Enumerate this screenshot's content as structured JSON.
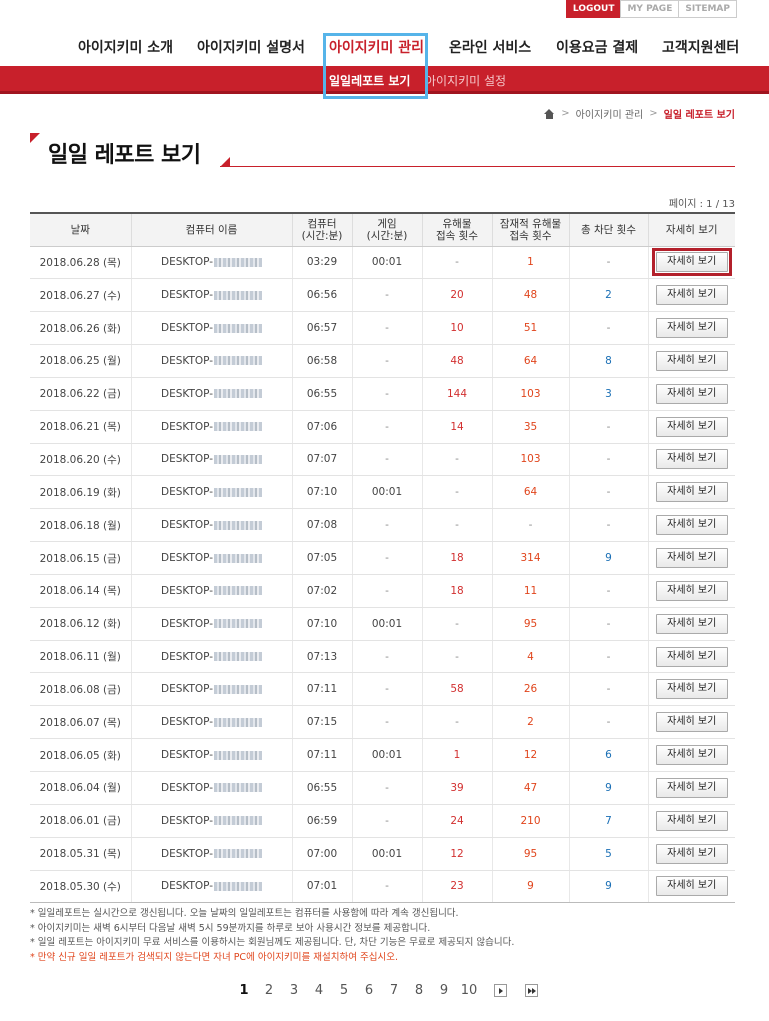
{
  "util": {
    "logout": "LOGOUT",
    "mypage": "MY PAGE",
    "sitemap": "SITEMAP"
  },
  "nav": {
    "items": [
      "아이지키미 소개",
      "아이지키미 설명서",
      "아이지키미 관리",
      "온라인 서비스",
      "이용요금 결제",
      "고객지원센터"
    ],
    "sub": [
      "일일레포트 보기",
      "아이지키미 설정"
    ]
  },
  "breadcrumb": {
    "level1": "아이지키미 관리",
    "current": "일일 레포트 보기"
  },
  "page_title": "일일 레포트 보기",
  "page_info": "페이지 : 1 / 13",
  "table": {
    "headers": [
      "날짜",
      "컴퓨터 이름",
      "컴퓨터\n(시간:분)",
      "게임\n(시간:분)",
      "유해물\n접속 횟수",
      "잠재적 유해물\n접속 횟수",
      "총 차단 횟수",
      "자세히 보기"
    ],
    "button_label": "자세히 보기",
    "rows": [
      {
        "date": "2018.06.28 (목)",
        "pc": "DESKTOP-",
        "pc_time": "03:29",
        "game": "00:01",
        "harm": "-",
        "potential": "1",
        "blocked": "-"
      },
      {
        "date": "2018.06.27 (수)",
        "pc": "DESKTOP-",
        "pc_time": "06:56",
        "game": "-",
        "harm": "20",
        "potential": "48",
        "blocked": "2"
      },
      {
        "date": "2018.06.26 (화)",
        "pc": "DESKTOP-",
        "pc_time": "06:57",
        "game": "-",
        "harm": "10",
        "potential": "51",
        "blocked": "-"
      },
      {
        "date": "2018.06.25 (월)",
        "pc": "DESKTOP-",
        "pc_time": "06:58",
        "game": "-",
        "harm": "48",
        "potential": "64",
        "blocked": "8"
      },
      {
        "date": "2018.06.22 (금)",
        "pc": "DESKTOP-",
        "pc_time": "06:55",
        "game": "-",
        "harm": "144",
        "potential": "103",
        "blocked": "3"
      },
      {
        "date": "2018.06.21 (목)",
        "pc": "DESKTOP-",
        "pc_time": "07:06",
        "game": "-",
        "harm": "14",
        "potential": "35",
        "blocked": "-"
      },
      {
        "date": "2018.06.20 (수)",
        "pc": "DESKTOP-",
        "pc_time": "07:07",
        "game": "-",
        "harm": "-",
        "potential": "103",
        "blocked": "-"
      },
      {
        "date": "2018.06.19 (화)",
        "pc": "DESKTOP-",
        "pc_time": "07:10",
        "game": "00:01",
        "harm": "-",
        "potential": "64",
        "blocked": "-"
      },
      {
        "date": "2018.06.18 (월)",
        "pc": "DESKTOP-",
        "pc_time": "07:08",
        "game": "-",
        "harm": "-",
        "potential": "-",
        "blocked": "-"
      },
      {
        "date": "2018.06.15 (금)",
        "pc": "DESKTOP-",
        "pc_time": "07:05",
        "game": "-",
        "harm": "18",
        "potential": "314",
        "blocked": "9"
      },
      {
        "date": "2018.06.14 (목)",
        "pc": "DESKTOP-",
        "pc_time": "07:02",
        "game": "-",
        "harm": "18",
        "potential": "11",
        "blocked": "-"
      },
      {
        "date": "2018.06.12 (화)",
        "pc": "DESKTOP-",
        "pc_time": "07:10",
        "game": "00:01",
        "harm": "-",
        "potential": "95",
        "blocked": "-"
      },
      {
        "date": "2018.06.11 (월)",
        "pc": "DESKTOP-",
        "pc_time": "07:13",
        "game": "-",
        "harm": "-",
        "potential": "4",
        "blocked": "-"
      },
      {
        "date": "2018.06.08 (금)",
        "pc": "DESKTOP-",
        "pc_time": "07:11",
        "game": "-",
        "harm": "58",
        "potential": "26",
        "blocked": "-"
      },
      {
        "date": "2018.06.07 (목)",
        "pc": "DESKTOP-",
        "pc_time": "07:15",
        "game": "-",
        "harm": "-",
        "potential": "2",
        "blocked": "-"
      },
      {
        "date": "2018.06.05 (화)",
        "pc": "DESKTOP-",
        "pc_time": "07:11",
        "game": "00:01",
        "harm": "1",
        "potential": "12",
        "blocked": "6"
      },
      {
        "date": "2018.06.04 (월)",
        "pc": "DESKTOP-",
        "pc_time": "06:55",
        "game": "-",
        "harm": "39",
        "potential": "47",
        "blocked": "9"
      },
      {
        "date": "2018.06.01 (금)",
        "pc": "DESKTOP-",
        "pc_time": "06:59",
        "game": "-",
        "harm": "24",
        "potential": "210",
        "blocked": "7"
      },
      {
        "date": "2018.05.31 (목)",
        "pc": "DESKTOP-",
        "pc_time": "07:00",
        "game": "00:01",
        "harm": "12",
        "potential": "95",
        "blocked": "5"
      },
      {
        "date": "2018.05.30 (수)",
        "pc": "DESKTOP-",
        "pc_time": "07:01",
        "game": "-",
        "harm": "23",
        "potential": "9",
        "blocked": "9"
      }
    ]
  },
  "notes": [
    "* 일일레포트는 실시간으로 갱신됩니다. 오늘 날짜의 일일레포트는 컴퓨터를 사용함에 따라 계속 갱신됩니다.",
    "* 아이지키미는 새벽 6시부터 다음날 새벽 5시 59분까지를 하루로 보아 사용시간 정보를 제공합니다.",
    "* 일일 레포트는 아이지키미 무료 서비스를 이용하시는 회원님께도 제공됩니다. 단, 차단 기능은 무료로 제공되지 않습니다.",
    "* 만약 신규 일일 레포트가 검색되지 않는다면 자녀 PC에 아이지키미를 재설치하여 주십시오."
  ],
  "pagination": {
    "pages": [
      "1",
      "2",
      "3",
      "4",
      "5",
      "6",
      "7",
      "8",
      "9",
      "10"
    ],
    "current": "1"
  },
  "colors": {
    "brand_red": "#c8202b",
    "harm_red": "#d23030",
    "potential_orange": "#e0451c",
    "blocked_blue": "#1a6fb5",
    "highlight_box": "#56b4e9"
  }
}
